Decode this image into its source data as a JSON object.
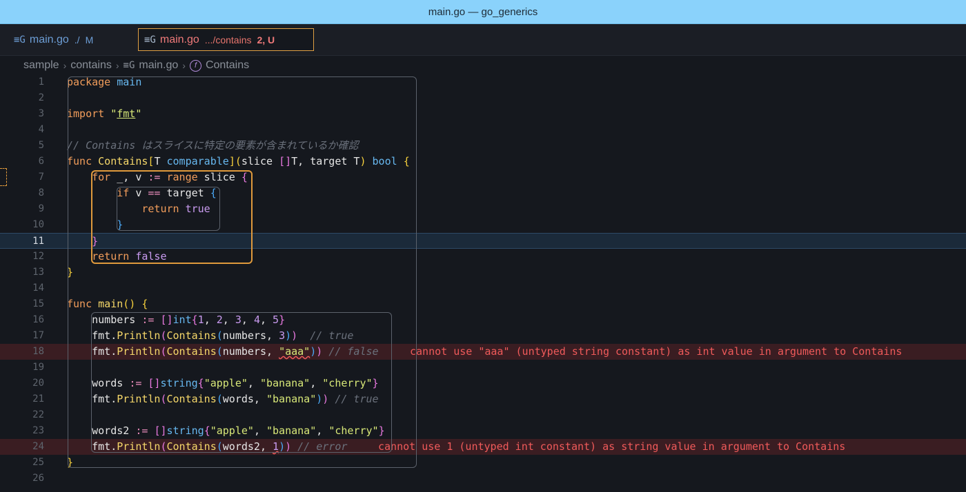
{
  "window": {
    "title": "main.go — go_generics"
  },
  "tabs": [
    {
      "icon": "go-file-icon",
      "label": "main.go",
      "path": "./",
      "status": "M"
    },
    {
      "icon": "go-file-icon",
      "label": "main.go",
      "path": ".../contains",
      "status": "2, U"
    }
  ],
  "breadcrumb": {
    "items": [
      "sample",
      "contains",
      "main.go",
      "Contains"
    ]
  },
  "editor": {
    "line_numbers": [
      "1",
      "2",
      "3",
      "4",
      "5",
      "6",
      "7",
      "8",
      "9",
      "10",
      "11",
      "12",
      "13",
      "14",
      "15",
      "16",
      "17",
      "18",
      "19",
      "20",
      "21",
      "22",
      "23",
      "24",
      "25",
      "26"
    ],
    "current_line": "11",
    "comment_line5": "// Contains はスライスに特定の要素が含まれているか確認",
    "diagnostics": {
      "line18": "cannot use \"aaa\" (untyped string constant) as int value in argument to Contains",
      "line24": "cannot use 1 (untyped int constant) as string value in argument to Contains"
    }
  },
  "colors": {
    "titlebar": "#8ad2fb",
    "active_tab_border": "#e0a043",
    "error": "#f05a5a",
    "background": "#15181e"
  }
}
